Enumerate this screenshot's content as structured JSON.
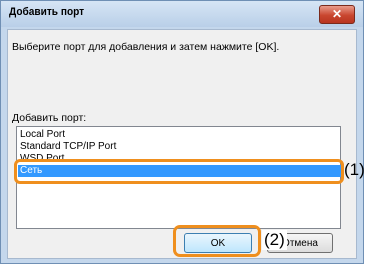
{
  "dialog": {
    "title": "Добавить порт",
    "close_glyph": "✕",
    "instruction": "Выберите порт для добавления и затем нажмите [OK].",
    "list_label": "Добавить порт:",
    "ports": [
      "Local Port",
      "Standard TCP/IP Port",
      "WSD Port",
      "Сеть"
    ],
    "selected_port": "Сеть",
    "ok_label": "OK",
    "cancel_label": "Отмена"
  },
  "callouts": {
    "list": "(1)",
    "ok": "(2)"
  },
  "colors": {
    "highlight": "#ef8f1e",
    "selection": "#3399ff"
  }
}
